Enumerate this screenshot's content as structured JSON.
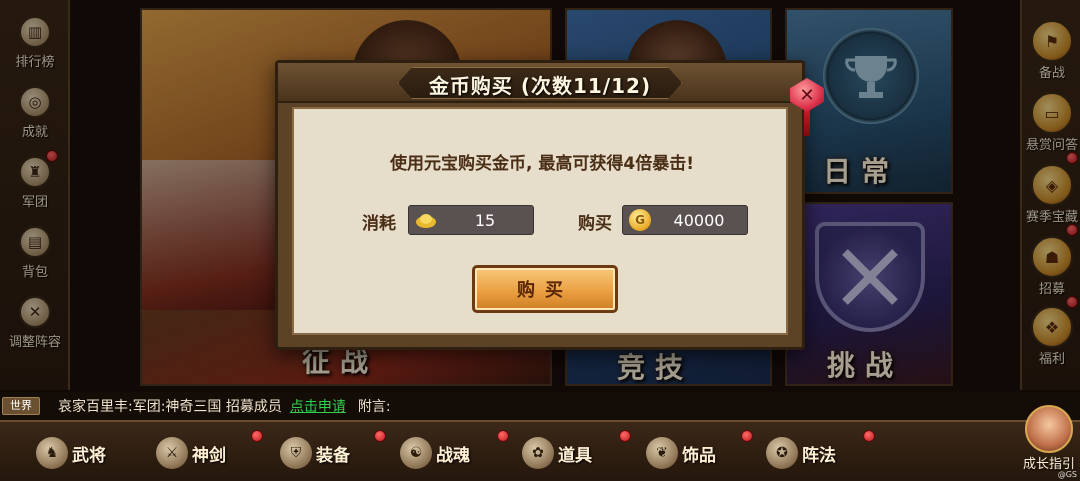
{
  "left_sidebar": {
    "items": [
      {
        "label": "排行榜",
        "icon": "bar-chart-icon"
      },
      {
        "label": "成就",
        "icon": "medal-icon"
      },
      {
        "label": "军团",
        "icon": "helmet-icon"
      },
      {
        "label": "背包",
        "icon": "bag-icon"
      },
      {
        "label": "调整阵容",
        "icon": "crossed-swords-icon"
      }
    ]
  },
  "cards": {
    "zhengzhan": {
      "title": "征战"
    },
    "middle": {
      "title": "竞技"
    },
    "richang": {
      "title": "日常",
      "icon": "trophy-icon"
    },
    "tiaozhan": {
      "title": "挑战",
      "icon": "crossed-swords-shield-icon"
    }
  },
  "right_sidebar": {
    "items": [
      {
        "label": "备战",
        "icon": "flag-icon"
      },
      {
        "label": "悬赏问答",
        "icon": "book-icon"
      },
      {
        "label": "赛季宝藏",
        "icon": "treasure-icon"
      },
      {
        "label": "招募",
        "icon": "recruit-icon"
      },
      {
        "label": "福利",
        "icon": "gift-icon"
      }
    ]
  },
  "chat": {
    "channel": "世界",
    "sender": "哀家百里丰:军团:神奇三国 招募成员",
    "link": "点击申请",
    "note": "附言:"
  },
  "bottom_nav": {
    "items": [
      {
        "label": "武将",
        "icon": "general-icon"
      },
      {
        "label": "神剑",
        "icon": "sword-icon"
      },
      {
        "label": "装备",
        "icon": "armor-icon"
      },
      {
        "label": "战魂",
        "icon": "soul-icon"
      },
      {
        "label": "道具",
        "icon": "item-icon"
      },
      {
        "label": "饰品",
        "icon": "accessory-icon"
      },
      {
        "label": "阵法",
        "icon": "formation-icon"
      }
    ],
    "growth_guide": "成长指引",
    "watermark": "@GS"
  },
  "dialog": {
    "title": "金币购买 (次数11/12)",
    "description": "使用元宝购买金币, 最高可获得4倍暴击!",
    "cost_label": "消耗",
    "cost_value": "15",
    "cost_icon": "ingot-icon",
    "buy_label": "购买",
    "buy_value": "40000",
    "buy_icon": "gold-coin-icon",
    "button_label": "购买",
    "close_icon": "close-icon",
    "colors": {
      "accent": "#eaa043",
      "body": "#e7ddcb",
      "frame": "#5c4326"
    }
  }
}
